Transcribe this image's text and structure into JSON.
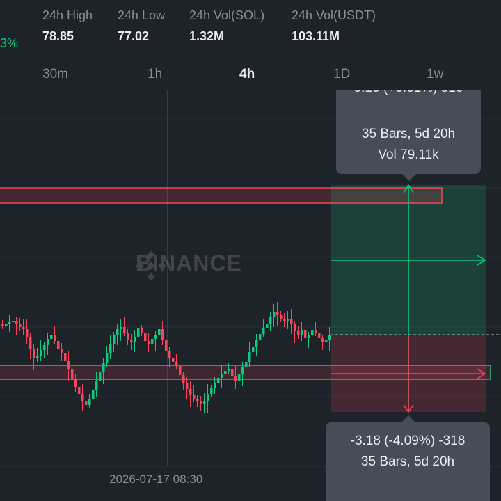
{
  "header": {
    "change_partial": "3%",
    "stats": [
      {
        "label": "24h High",
        "value": "78.85"
      },
      {
        "label": "24h Low",
        "value": "77.02"
      },
      {
        "label": "24h Vol(SOL)",
        "value": "1.32M"
      },
      {
        "label": "24h Vol(USDT)",
        "value": "103.11M"
      }
    ]
  },
  "timeframes": {
    "items": [
      "30m",
      "1h",
      "4h",
      "1D",
      "1w"
    ],
    "active": "4h"
  },
  "chart": {
    "watermark": "BINANCE",
    "x_axis_label": "2026-07-17 08:30",
    "measure_up": {
      "line1_partial": "5.16 (+6.61%) 516",
      "line2": "35 Bars, 5d 20h",
      "line3": "Vol 79.11k"
    },
    "measure_down": {
      "line1": "-3.18 (-4.09%) -318",
      "line2": "35 Bars, 5d 20h"
    },
    "colors": {
      "up": "#0ecb81",
      "down": "#f6465d",
      "background": "#1e2329",
      "tooltip": "#474d57"
    }
  }
}
